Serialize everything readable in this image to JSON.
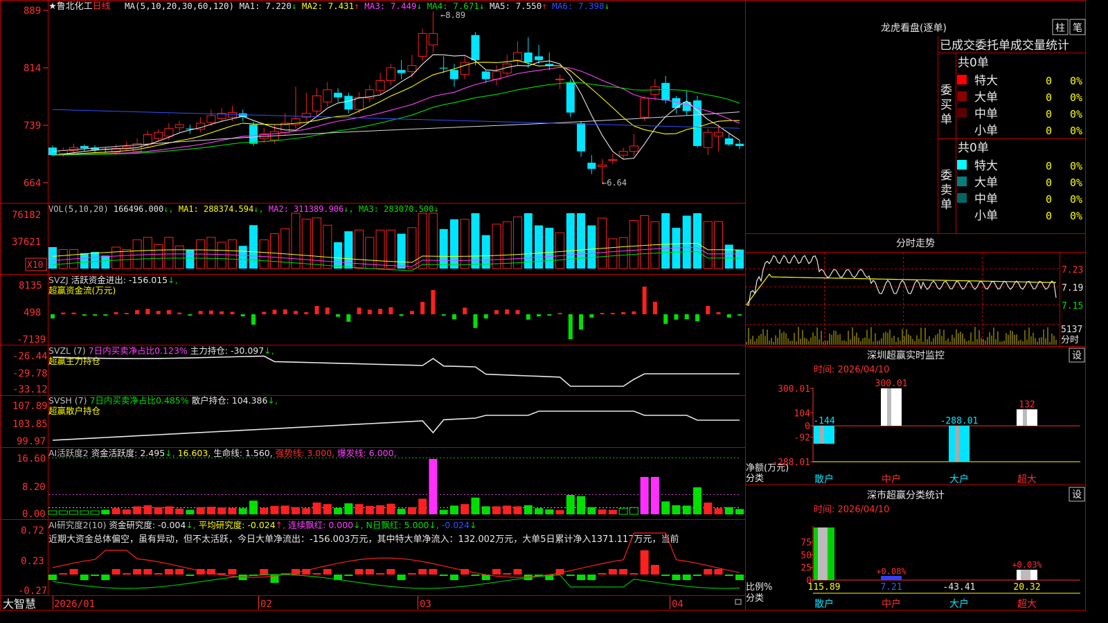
{
  "colors": {
    "up": "#ff2020",
    "down": "#00e5ff",
    "frame": "#c00000",
    "white": "#e8e8e8",
    "yellow": "#ffff00",
    "magenta": "#ff40ff",
    "green": "#00e000",
    "blue": "#3050ff",
    "gray": "#9a9a9a"
  },
  "header": {
    "star": "★",
    "stock": "鲁北化工",
    "period": "日线",
    "ma_def": "MA(5,10,20,30,60,120)",
    "items": [
      {
        "label": "MA1:",
        "value": "7.220",
        "arrow": "↓",
        "color": "#e8e8e8"
      },
      {
        "label": "MA2:",
        "value": "7.431",
        "arrow": "↑",
        "color": "#ffff00"
      },
      {
        "label": "MA3:",
        "value": "7.449",
        "arrow": "↓",
        "color": "#ff40ff"
      },
      {
        "label": "MA4:",
        "value": "7.671",
        "arrow": "↓",
        "color": "#00e000"
      },
      {
        "label": "MA5:",
        "value": "7.550",
        "arrow": "↑",
        "color": "#e8e8e8"
      },
      {
        "label": "MA6:",
        "value": "7.398",
        "arrow": "↓",
        "color": "#3050ff"
      }
    ]
  },
  "price_axis": [
    "889",
    "814",
    "739",
    "664"
  ],
  "high_note": "8.89",
  "low_note": "6.64",
  "vol": {
    "label": "VOL(5,10,20)",
    "value": "166496.000",
    "arrow": "↓",
    "ma1": "288374.594",
    "ma2": "311389.906",
    "ma3": "283070.500",
    "ticks": [
      "76182",
      "37621"
    ],
    "unit": "X10"
  },
  "svzj": {
    "label": "SVZJ",
    "title": "活跃资金进出:",
    "value": "-156.015",
    "arrow": "↓",
    "sub": "超赢资金流(万元)",
    "ticks": [
      "8135",
      "498",
      "-7139"
    ]
  },
  "svzl": {
    "label": "SVZL (7)",
    "pct": "7日内买卖净占比0.123%",
    "title": "主力持仓:",
    "value": "-30.097",
    "arrow": "↓",
    "sub": "超赢主力持仓",
    "ticks": [
      "-26.44",
      "-29.78",
      "-33.12"
    ]
  },
  "svsh": {
    "label": "SVSH (7)",
    "pct": "7日内买卖净占比0.485%",
    "title": "散户持仓:",
    "value": "104.386",
    "arrow": "↓",
    "sub": "超赢散户持仓",
    "ticks": [
      "107.89",
      "103.85",
      "99.97"
    ]
  },
  "ai1": {
    "label": "AI活跃度2",
    "t1": "资金活跃度:",
    "v1": "2.495",
    "v2": "16.603",
    "t3": "生命线:",
    "v3": "1.560",
    "t4": "强势线:",
    "v4": "3.000",
    "t5": "爆发线:",
    "v5": "6.000",
    "ticks": [
      "16.60",
      "8.20",
      "0.00"
    ]
  },
  "ai2": {
    "label": "AI研究度2(10)",
    "t1": "资金研究度:",
    "v1": "-0.004",
    "t2": "平均研究度:",
    "v2": "-0.024",
    "t3": "连续飘红:",
    "v3": "0.000",
    "t4": "N日飘红:",
    "v4": "5.000",
    "v5": "-0.024",
    "ticks": [
      "0.72",
      "0.23",
      "-0.27"
    ],
    "comment": "近期大资金总体偏空，虽有异动，但不太活跃，今日大单净流出：-156.003万元，其中特大单净流入：132.002万元，大单5日累计净入1371.117万元，当前"
  },
  "xaxis": {
    "brand": "大智慧",
    "labels": [
      "2026/01",
      "02",
      "03",
      "04"
    ]
  },
  "chart_data": {
    "type": "candlestick",
    "title": "鲁北化工 日线",
    "ylim": [
      6.4,
      8.95
    ],
    "candles": [
      [
        7.1,
        7.0,
        7.13,
        6.99
      ],
      [
        7.02,
        7.06,
        7.1,
        6.98
      ],
      [
        7.06,
        7.1,
        7.15,
        7.03
      ],
      [
        7.12,
        7.09,
        7.14,
        7.05
      ],
      [
        7.1,
        7.07,
        7.13,
        7.03
      ],
      [
        7.08,
        7.07,
        7.1,
        7.03
      ],
      [
        7.04,
        7.09,
        7.14,
        7.0
      ],
      [
        7.09,
        7.11,
        7.18,
        7.06
      ],
      [
        7.05,
        7.15,
        7.22,
        7.02
      ],
      [
        7.14,
        7.27,
        7.32,
        7.1
      ],
      [
        7.22,
        7.3,
        7.34,
        7.18
      ],
      [
        7.25,
        7.35,
        7.42,
        7.2
      ],
      [
        7.36,
        7.4,
        7.45,
        7.3
      ],
      [
        7.35,
        7.34,
        7.4,
        7.28
      ],
      [
        7.34,
        7.42,
        7.5,
        7.3
      ],
      [
        7.43,
        7.52,
        7.6,
        7.38
      ],
      [
        7.48,
        7.55,
        7.62,
        7.44
      ],
      [
        7.5,
        7.56,
        7.65,
        7.45
      ],
      [
        7.55,
        7.5,
        7.6,
        7.45
      ],
      [
        7.4,
        7.15,
        7.44,
        7.12
      ],
      [
        7.22,
        7.28,
        7.36,
        7.16
      ],
      [
        7.2,
        7.31,
        7.4,
        7.15
      ],
      [
        7.3,
        7.42,
        7.55,
        7.26
      ],
      [
        7.4,
        7.48,
        7.9,
        7.35
      ],
      [
        7.5,
        7.55,
        7.82,
        7.45
      ],
      [
        7.58,
        7.78,
        7.88,
        7.5
      ],
      [
        7.7,
        7.86,
        7.96,
        7.64
      ],
      [
        7.82,
        7.76,
        7.88,
        7.7
      ],
      [
        7.78,
        7.6,
        7.82,
        7.55
      ],
      [
        7.6,
        7.76,
        7.83,
        7.55
      ],
      [
        7.75,
        7.86,
        7.92,
        7.7
      ],
      [
        7.85,
        7.98,
        8.08,
        7.8
      ],
      [
        7.98,
        8.15,
        8.2,
        7.92
      ],
      [
        8.12,
        8.08,
        8.25,
        8.0
      ],
      [
        8.1,
        8.18,
        8.32,
        8.02
      ],
      [
        8.3,
        8.6,
        8.66,
        8.24
      ],
      [
        8.45,
        8.6,
        8.89,
        8.35
      ],
      [
        8.15,
        8.14,
        8.3,
        8.08
      ],
      [
        8.12,
        8.0,
        8.2,
        7.9
      ],
      [
        8.06,
        8.22,
        8.3,
        8.0
      ],
      [
        8.58,
        8.25,
        8.62,
        8.18
      ],
      [
        8.1,
        8.0,
        8.12,
        7.95
      ],
      [
        8.0,
        8.1,
        8.18,
        7.92
      ],
      [
        8.08,
        8.2,
        8.32,
        8.04
      ],
      [
        8.25,
        8.35,
        8.5,
        8.18
      ],
      [
        8.35,
        8.22,
        8.55,
        8.15
      ],
      [
        8.3,
        8.25,
        8.45,
        8.2
      ],
      [
        8.2,
        8.18,
        8.35,
        8.12
      ],
      [
        8.0,
        8.0,
        8.06,
        7.87
      ],
      [
        7.96,
        7.56,
        8.0,
        7.5
      ],
      [
        7.42,
        7.05,
        7.45,
        6.98
      ],
      [
        6.9,
        6.82,
        7.0,
        6.75
      ],
      [
        6.85,
        6.87,
        6.95,
        6.64
      ],
      [
        6.93,
        6.94,
        7.02,
        6.88
      ],
      [
        7.0,
        7.05,
        7.1,
        6.95
      ],
      [
        7.05,
        7.12,
        7.28,
        6.99
      ],
      [
        7.5,
        7.75,
        7.78,
        7.45
      ],
      [
        7.8,
        7.9,
        8.0,
        7.72
      ],
      [
        7.95,
        7.72,
        8.04,
        7.68
      ],
      [
        7.75,
        7.62,
        7.78,
        7.55
      ],
      [
        7.7,
        7.58,
        7.85,
        7.52
      ],
      [
        7.72,
        7.12,
        7.78,
        7.1
      ],
      [
        7.1,
        7.3,
        7.35,
        7.0
      ],
      [
        7.25,
        7.3,
        7.4,
        7.05
      ],
      [
        7.22,
        7.14,
        7.28,
        7.12
      ],
      [
        7.15,
        7.12,
        7.2,
        7.08
      ]
    ]
  },
  "right": {
    "lhkp": {
      "title": "龙虎看盘(逐单)",
      "btn1": "柱",
      "btn2": "笔",
      "heading": "已成交委托单成交量统计",
      "buy": {
        "side": "委买单",
        "total": "共0单",
        "rows": [
          {
            "name": "特大",
            "v": "0",
            "p": "0%",
            "color": "#ff0000"
          },
          {
            "name": "大单",
            "v": "0",
            "p": "0%",
            "color": "#8b0000"
          },
          {
            "name": "中单",
            "v": "0",
            "p": "0%",
            "color": "#5a0000"
          },
          {
            "name": "小单",
            "v": "0",
            "p": "0%",
            "color": ""
          }
        ]
      },
      "sell": {
        "side": "委卖单",
        "total": "共0单",
        "rows": [
          {
            "name": "特大",
            "v": "0",
            "p": "0%",
            "color": "#00ffff"
          },
          {
            "name": "大单",
            "v": "0",
            "p": "0%",
            "color": "#008080"
          },
          {
            "name": "中单",
            "v": "0",
            "p": "0%",
            "color": "#006666"
          },
          {
            "name": "小单",
            "v": "0",
            "p": "0%",
            "color": ""
          }
        ]
      }
    },
    "fs": {
      "title": "分时走势",
      "ticks": [
        "7.23",
        "7.19",
        "7.15"
      ],
      "vol": "5137",
      "unit": "分时"
    },
    "sz1": {
      "title": "深圳超赢实时监控",
      "btn": "设",
      "date": "时间: 2026/04/10",
      "ylab": "净额(万元)",
      "xlab": "分类",
      "ticks": [
        "300.01",
        "104",
        "0",
        "-92",
        "-288.01"
      ],
      "bars": [
        {
          "cat": "散户",
          "value": -144,
          "label": "-144"
        },
        {
          "cat": "中户",
          "value": 300.01,
          "label": "300.01"
        },
        {
          "cat": "大户",
          "value": -288.01,
          "label": "-288.01"
        },
        {
          "cat": "超大",
          "value": 132,
          "label": "132"
        }
      ]
    },
    "sz2": {
      "title": "深市超赢分类统计",
      "btn": "设",
      "date": "时间: 2026/04/10",
      "ylab": "比例%",
      "xlab": "分类",
      "ticks": [
        "75",
        "50",
        "25",
        "0"
      ],
      "bars": [
        {
          "cat": "散户",
          "value": 115.89,
          "label": "115.89"
        },
        {
          "cat": "中户",
          "value": 7.21,
          "label": "7.21",
          "note": "+0.08%"
        },
        {
          "cat": "大户",
          "value": -43.41,
          "label": "-43.41"
        },
        {
          "cat": "超大",
          "value": 20.32,
          "label": "20.32",
          "note": "+0.03%"
        }
      ]
    }
  }
}
